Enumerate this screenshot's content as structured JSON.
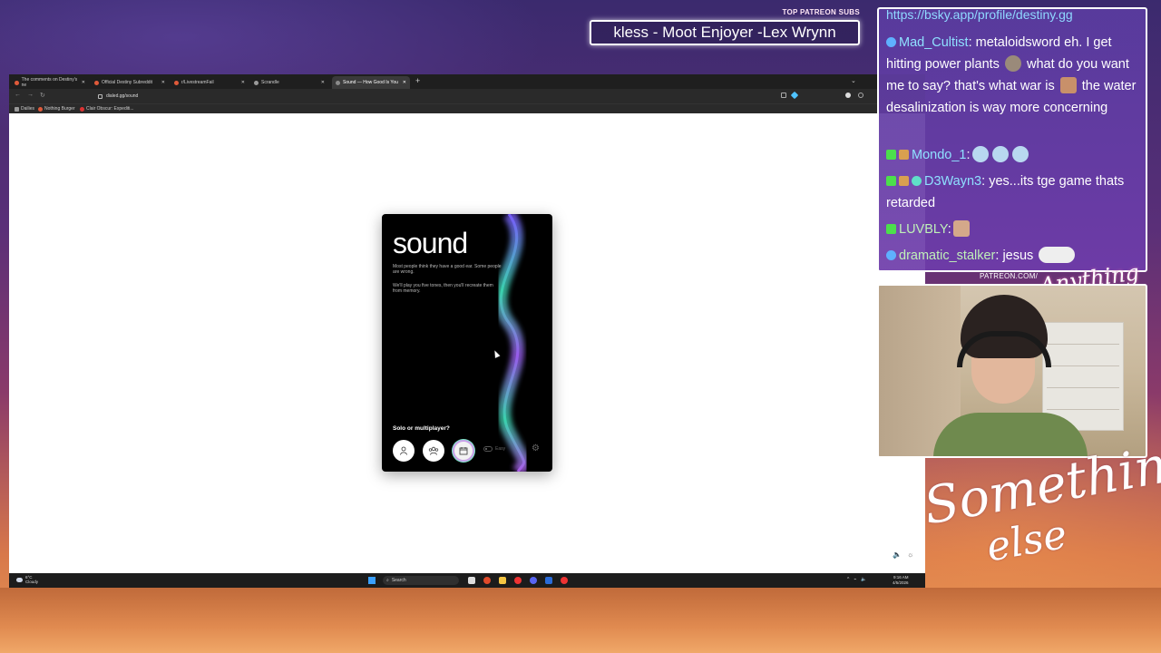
{
  "overlay": {
    "sub_label": "TOP PATREON SUBS",
    "sub_name": "kless - Moot Enjoyer -Lex Wrynn",
    "patreon_label": "PATREON.COM/",
    "anything_else_logo": "Anything Else",
    "something_else_logo_line1": "Something",
    "something_else_logo_line2": "else"
  },
  "browser": {
    "tabs": [
      {
        "label": "The comments on Destiny's ne",
        "active": false
      },
      {
        "label": "Official Destiny Subreddit",
        "active": false
      },
      {
        "label": "r/LivestreamFail",
        "active": false
      },
      {
        "label": "Scrandle",
        "active": false
      },
      {
        "label": "Sound — How Good Is You",
        "active": true
      }
    ],
    "url": "dialed.gg/sound",
    "bookmarks": [
      "Dailies",
      "Nothing Burger",
      "Clair Obscur: Expediti..."
    ]
  },
  "sound_card": {
    "title": "sound",
    "text1": "Most people think they have a good ear. Some people are wrong.",
    "text2": "We'll play you five tones, then you'll recreate them from memory.",
    "mode_label": "Solo or multiplayer?",
    "easy_label": "Easy",
    "icons": {
      "solo": "person-icon",
      "multi": "group-icon",
      "daily": "calendar-icon",
      "settings": "gear-icon"
    }
  },
  "taskbar": {
    "weather_temp": "6°C",
    "weather_desc": "Cloudy",
    "search_label": "Search",
    "time": "9:16 AM",
    "date": "4/5/2026"
  },
  "chat": {
    "top_link": "https://bsky.app/profile/destiny.gg",
    "messages": [
      {
        "user": "Mad_Cultist",
        "text": "metaloidsword eh. I get hitting power plants",
        "text2": "what do you want me to say? that's what war is",
        "text3": "the water desalinization is way more concerning"
      },
      {
        "user": "Mondo_1",
        "text": ""
      },
      {
        "user": "D3Wayn3",
        "text": "yes...its tge game thats retarded"
      },
      {
        "user": "LUVBLY",
        "text": ""
      },
      {
        "user": "dramatic_stalker",
        "text": "jesus"
      }
    ]
  },
  "colors": {
    "chat_bg": "#6a40a8",
    "link": "#8fd8ff",
    "accent_card": "#000000"
  }
}
